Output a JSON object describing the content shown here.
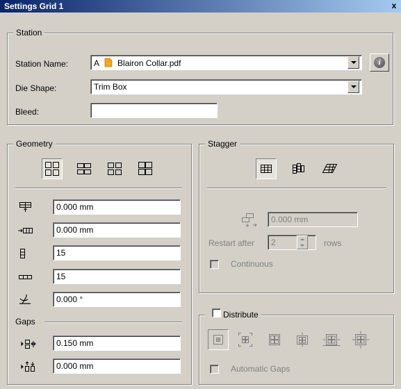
{
  "window": {
    "title": "Settings Grid 1",
    "close_label": "x"
  },
  "station": {
    "legend": "Station",
    "name_label": "Station Name:",
    "name_value": "Blairon Collar.pdf",
    "name_prefix": "A",
    "die_label": "Die Shape:",
    "die_value": "Trim Box",
    "bleed_label": "Bleed:",
    "bleed_value": "",
    "info_icon": "info-icon"
  },
  "geometry": {
    "legend": "Geometry",
    "layout_icons": [
      "layout-grid-1-icon",
      "layout-grid-2-icon",
      "layout-grid-3-icon",
      "layout-grid-4-icon"
    ],
    "fields": [
      {
        "icon": "horizontal-offset-icon",
        "value": "0.000 mm"
      },
      {
        "icon": "vertical-offset-icon",
        "value": "0.000 mm"
      },
      {
        "icon": "rows-icon",
        "value": "15"
      },
      {
        "icon": "columns-icon",
        "value": "15"
      },
      {
        "icon": "rotation-icon",
        "value": "0.000 °"
      }
    ],
    "gaps_legend": "Gaps",
    "gaps": [
      {
        "icon": "horizontal-gap-icon",
        "value": "0.150 mm"
      },
      {
        "icon": "vertical-gap-icon",
        "value": "0.000 mm"
      }
    ]
  },
  "stagger": {
    "legend": "Stagger",
    "icons": [
      "stagger-none-icon",
      "stagger-columns-icon",
      "stagger-rows-icon"
    ],
    "offset_value": "0.000 mm",
    "restart_label": "Restart after",
    "restart_value": "2",
    "restart_unit": "rows",
    "continuous_label": "Continuous"
  },
  "distribute": {
    "legend": "Distribute",
    "icons": [
      "distribute-none-icon",
      "distribute-center-icon",
      "distribute-fill-icon",
      "distribute-vertical-icon",
      "distribute-horizontal-icon",
      "distribute-both-icon"
    ],
    "auto_gaps_label": "Automatic Gaps"
  }
}
